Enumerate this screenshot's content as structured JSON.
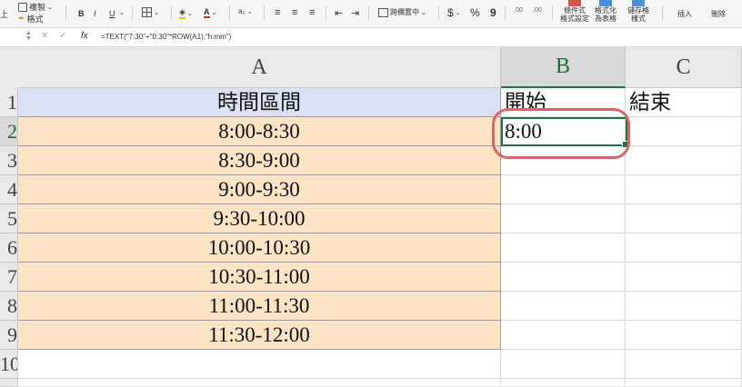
{
  "ribbon": {
    "paste_suffix": "上",
    "copy_label": "複製",
    "format_label": "格式",
    "bold": "B",
    "italic": "I",
    "underline": "U",
    "merge_label": "跨欄置中",
    "currency": "$",
    "percent": "%",
    "comma": "9",
    "dec_increase": ".00",
    "dec_decrease": ".00",
    "cond_format_line1": "條件式",
    "cond_format_line2": "格式設定",
    "format_table_line1": "格式化",
    "format_table_line2": "為表格",
    "cell_styles_line1": "儲存格",
    "cell_styles_line2": "樣式",
    "insert_label": "插入",
    "delete_label": "刪除"
  },
  "formula_bar": {
    "fx": "fx",
    "formula": "=TEXT(\"7:30\"+\"0:30\"*ROW(A1),\"h:mm\")"
  },
  "columns": [
    "A",
    "B",
    "C"
  ],
  "rows": [
    "1",
    "2",
    "3",
    "4",
    "5",
    "6",
    "7",
    "8",
    "9",
    "10"
  ],
  "sheet": {
    "header_a": "時間區間",
    "header_b": "開始",
    "header_c": "結束",
    "intervals": [
      "8:00-8:30",
      "8:30-9:00",
      "9:00-9:30",
      "9:30-10:00",
      "10:00-10:30",
      "10:30-11:00",
      "11:00-11:30",
      "11:30-12:00"
    ],
    "b2": "8:00"
  },
  "colors": {
    "header_fill": "#d9e1f2",
    "data_fill": "#fce4c4",
    "selection": "#217346",
    "annotation": "#d86767"
  }
}
